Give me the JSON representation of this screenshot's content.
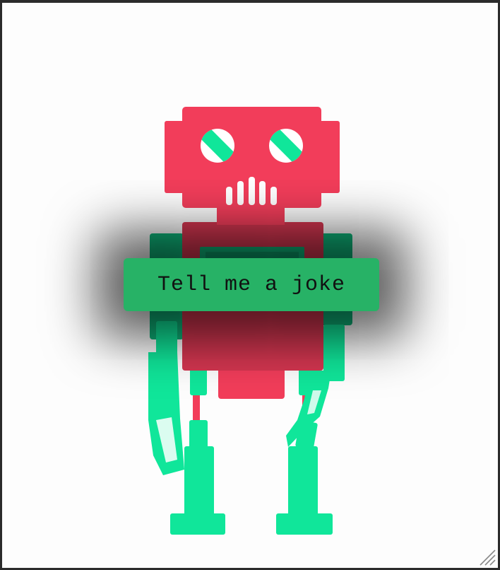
{
  "button": {
    "label": "Tell me a joke"
  },
  "colors": {
    "robot_red": "#f23d5a",
    "robot_dark_red": "#d43650",
    "robot_green": "#10e69a",
    "robot_dark_green": "#0fb57a",
    "button_green": "#27b266",
    "background": "#fdfdfd"
  },
  "icons": {
    "illustration": "robot-illustration",
    "resize": "resize-grip-icon"
  }
}
